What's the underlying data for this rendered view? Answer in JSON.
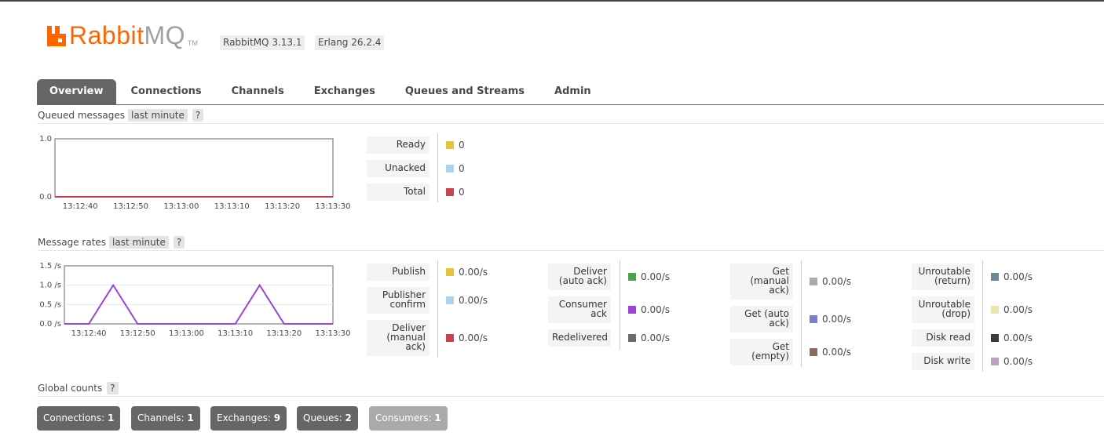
{
  "header": {
    "logo_rabbit": "Rabbit",
    "logo_mq": "MQ",
    "logo_tm": "TM",
    "version": "RabbitMQ 3.13.1",
    "erlang": "Erlang 26.2.4"
  },
  "tabs": [
    {
      "label": "Overview",
      "active": true
    },
    {
      "label": "Connections"
    },
    {
      "label": "Channels"
    },
    {
      "label": "Exchanges"
    },
    {
      "label": "Queues and Streams"
    },
    {
      "label": "Admin"
    }
  ],
  "queued": {
    "title": "Queued messages",
    "range": "last minute",
    "help": "?",
    "legend": [
      {
        "label": "Ready",
        "value": "0",
        "color": "#e5c33b"
      },
      {
        "label": "Unacked",
        "value": "0",
        "color": "#aad4f2"
      },
      {
        "label": "Total",
        "value": "0",
        "color": "#c8434b"
      }
    ]
  },
  "rates": {
    "title": "Message rates",
    "range": "last minute",
    "help": "?",
    "col1": [
      {
        "label": [
          "Publish"
        ],
        "value": "0.00/s",
        "color": "#e5c33b"
      },
      {
        "label": [
          "Publisher",
          "confirm"
        ],
        "value": "0.00/s",
        "color": "#aad4f2"
      },
      {
        "label": [
          "Deliver",
          "(manual",
          "ack)"
        ],
        "value": "0.00/s",
        "color": "#c8434b"
      }
    ],
    "col2": [
      {
        "label": [
          "Deliver",
          "(auto ack)"
        ],
        "value": "0.00/s",
        "color": "#4aa24c"
      },
      {
        "label": [
          "Consumer",
          "ack"
        ],
        "value": "0.00/s",
        "color": "#9b44d8"
      },
      {
        "label": [
          "Redelivered"
        ],
        "value": "0.00/s",
        "color": "#6b6b6b"
      }
    ],
    "col3": [
      {
        "label": [
          "Get",
          "(manual",
          "ack)"
        ],
        "value": "0.00/s",
        "color": "#aaaaaa"
      },
      {
        "label": [
          "Get (auto",
          "ack)"
        ],
        "value": "0.00/s",
        "color": "#7a80c8"
      },
      {
        "label": [
          "Get",
          "(empty)"
        ],
        "value": "0.00/s",
        "color": "#8f6a64"
      }
    ],
    "col4": [
      {
        "label": [
          "Unroutable",
          "(return)"
        ],
        "value": "0.00/s",
        "color": "#6f8695"
      },
      {
        "label": [
          "Unroutable",
          "(drop)"
        ],
        "value": "0.00/s",
        "color": "#e9e4b0"
      },
      {
        "label": [
          "Disk read"
        ],
        "value": "0.00/s",
        "color": "#3a3a44"
      },
      {
        "label": [
          "Disk write"
        ],
        "value": "0.00/s",
        "color": "#c59ec6"
      }
    ]
  },
  "global": {
    "title": "Global counts",
    "help": "?",
    "counts": [
      {
        "label": "Connections:",
        "value": "1"
      },
      {
        "label": "Channels:",
        "value": "1"
      },
      {
        "label": "Exchanges:",
        "value": "9"
      },
      {
        "label": "Queues:",
        "value": "2"
      },
      {
        "label": "Consumers:",
        "value": "1",
        "dim": true
      }
    ]
  },
  "chart_data": [
    {
      "type": "line",
      "x": [
        "13:12:40",
        "13:12:50",
        "13:13:00",
        "13:13:10",
        "13:13:20",
        "13:13:30"
      ],
      "ylim": [
        0,
        1.0
      ],
      "y_ticks": [
        "0.0",
        "1.0"
      ],
      "series": [
        {
          "name": "Total",
          "color": "#c8434b",
          "values": [
            0,
            0,
            0,
            0,
            0,
            0
          ]
        }
      ]
    },
    {
      "type": "line",
      "x": [
        "13:12:40",
        "13:12:50",
        "13:13:00",
        "13:13:10",
        "13:13:20",
        "13:13:30"
      ],
      "ylim": [
        0,
        1.5
      ],
      "y_ticks": [
        "0.0 /s",
        "0.5 /s",
        "1.0 /s",
        "1.5 /s"
      ],
      "series": [
        {
          "name": "Consumer ack",
          "color": "#9b44d8",
          "points": [
            [
              0,
              0
            ],
            [
              5,
              0
            ],
            [
              10,
              1.0
            ],
            [
              15,
              0
            ],
            [
              35,
              0
            ],
            [
              40,
              1.0
            ],
            [
              45,
              0
            ],
            [
              55,
              0
            ]
          ]
        }
      ]
    }
  ]
}
